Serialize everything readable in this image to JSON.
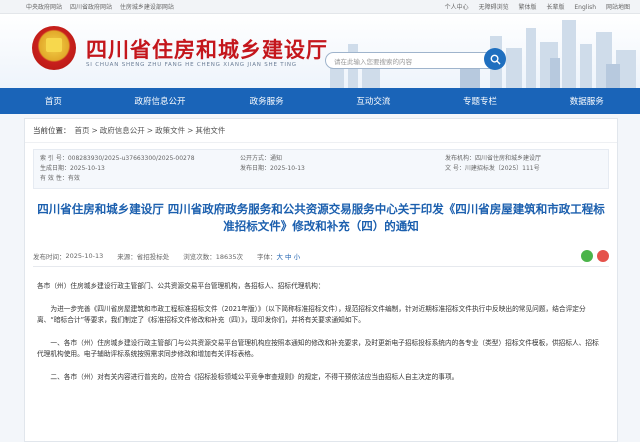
{
  "topbar": {
    "left": [
      "中央政府网站",
      "四川省政府网站",
      "住房城乡建设部网站"
    ],
    "right": [
      "个人中心",
      "无障碍浏览",
      "繁体版",
      "长辈版",
      "English",
      "网站地图"
    ]
  },
  "header": {
    "title": "四川省住房和城乡建设厅",
    "pinyin": "SI CHUAN SHENG ZHU FANG HE CHENG XIANG JIAN SHE TING",
    "search_placeholder": "请在此输入您要搜索的内容"
  },
  "nav": [
    "首页",
    "政府信息公开",
    "政务服务",
    "互动交流",
    "专题专栏",
    "数据服务"
  ],
  "breadcrumb": {
    "lead": "当前位置：",
    "items": [
      "首页",
      ">",
      "政府信息公开",
      ">",
      "政策文件",
      ">",
      "其他文件"
    ]
  },
  "meta": {
    "row1": [
      "索 引 号：008283930/2025-u37663300/2025-00278",
      "公开方式：通知",
      "发布机构：四川省住房和城乡建设厅"
    ],
    "row2": [
      "生成日期：2025-10-13",
      "发布日期：2025-10-13",
      "文 号：川建招标发〔2025〕111号"
    ],
    "row3": [
      "有 效 性：有效"
    ]
  },
  "article": {
    "title": "四川省住房和城乡建设厅 四川省政府政务服务和公共资源交易服务中心关于印发《四川省房屋建筑和市政工程标准招标文件》修改和补充（四）的通知",
    "date_label": "发布时间：",
    "date": "2025-10-13",
    "source_label": "来源：",
    "source": "省招投标处",
    "views_label": "浏览次数：",
    "views": "18635次",
    "font_label": "字体：",
    "font_options": [
      "大",
      "中",
      "小"
    ],
    "paragraphs": [
      "各市（州）住房城乡建设行政主管部门、公共资源交易平台管理机构，各招标人、招标代理机构：",
      "为进一步完善《四川省房屋建筑和市政工程标准招标文件（2021年版）》（以下简称标准招标文件），规范招标文件编制，针对近期标准招标文件执行中反映出的常见问题，结合评定分离、“暗标合计”等要求，我们制定了《标准招标文件修改和补充（四）》，现印发你们，并将有关要求通知如下。",
      "一、各市（州）住房城乡建设行政主管部门与公共资源交易平台管理机构应按照本通知的修改和补充要求，及时更新电子招标投标系统内的各专业（类型）招标文件模板，供招标人、招标代理机构使用。电子辅助评标系统按照需求同步修改和增加有关评标表格。",
      "二、各市（州）对有关内容进行普充的，应符合《招标投标领域公平竞争审查规则》的规定，不得干预依法应当由招标人自主决定的事项。"
    ]
  }
}
